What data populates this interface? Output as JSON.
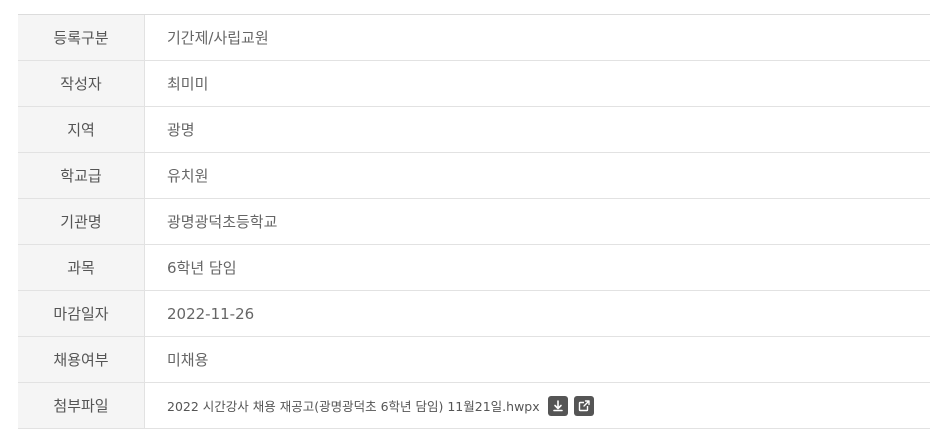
{
  "rows": [
    {
      "label": "등록구분",
      "value": "기간제/사립교원"
    },
    {
      "label": "작성자",
      "value": "최미미"
    },
    {
      "label": "지역",
      "value": "광명"
    },
    {
      "label": "학교급",
      "value": "유치원"
    },
    {
      "label": "기관명",
      "value": "광명광덕초등학교"
    },
    {
      "label": "과목",
      "value": "6학년 담임"
    },
    {
      "label": "마감일자",
      "value": "2022-11-26"
    },
    {
      "label": "채용여부",
      "value": "미채용"
    }
  ],
  "attachment": {
    "label": "첨부파일",
    "filename": "2022 시간강사 채용 재공고(광명광덕초 6학년 담임) 11월21일.hwpx",
    "download_icon": "download-icon",
    "external_icon": "external-link-icon"
  }
}
